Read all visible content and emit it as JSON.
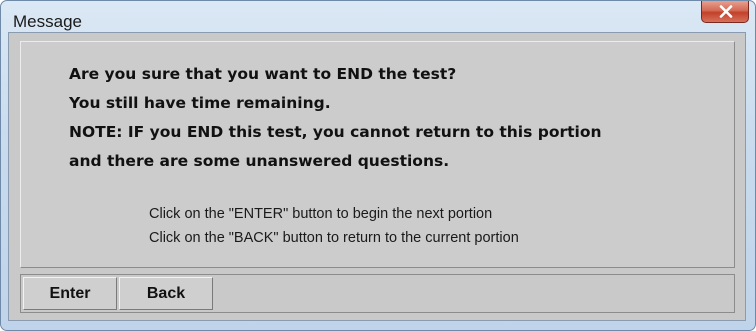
{
  "window": {
    "title": "Message",
    "close_icon": "close-x-icon"
  },
  "message": {
    "lines": [
      "Are you sure that you want to END the test?",
      "You still have time remaining.",
      "NOTE: IF you END this test, you cannot return to this portion",
      "and there are some unanswered questions."
    ],
    "instructions": [
      "Click on the \"ENTER\" button to begin the next portion",
      "Click on the \"BACK\" button to return to the current portion"
    ]
  },
  "buttons": {
    "enter_label": "Enter",
    "back_label": "Back"
  },
  "colors": {
    "close_button": "#c2412b",
    "panel_background": "#cccccc",
    "title_bar": "#c9dcee"
  }
}
